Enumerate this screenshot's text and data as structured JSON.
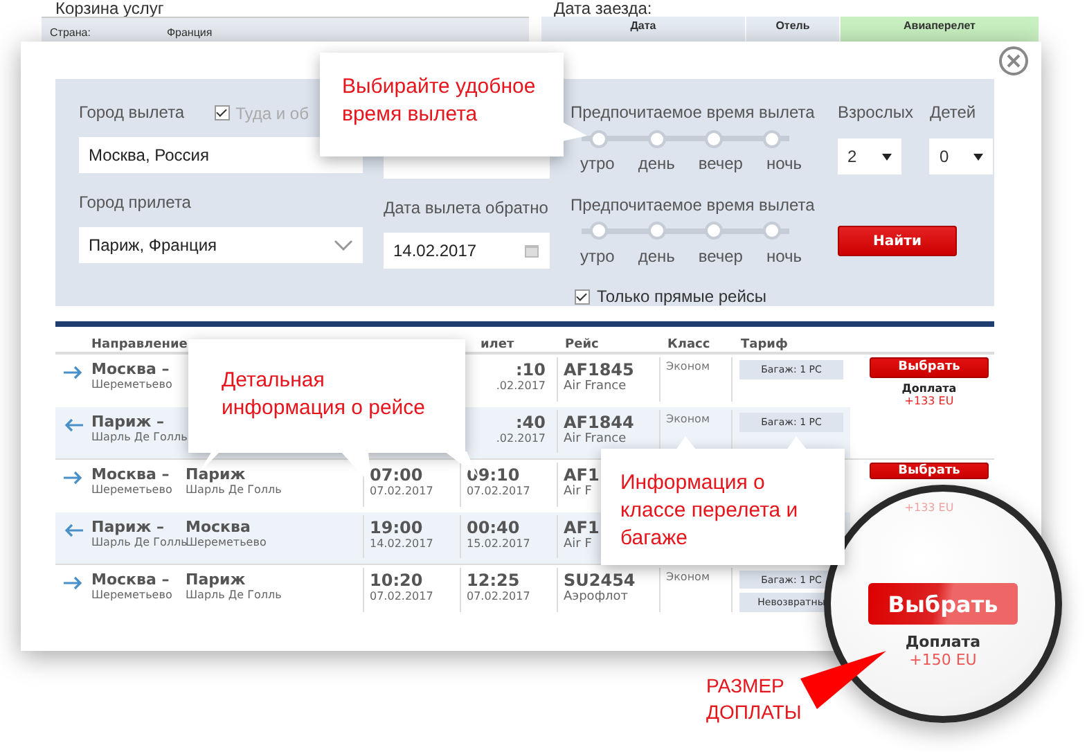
{
  "background_page": {
    "cart_title": "Корзина услуг",
    "country_label": "Страна:",
    "country_value": "Франция",
    "checkin_label": "Дата заезда:",
    "columns": [
      "Дата",
      "Отель",
      "Авиаперелет"
    ]
  },
  "search": {
    "departure_city_label": "Город вылета",
    "round_trip": {
      "label": "Туда и об",
      "checked": true
    },
    "departure_city": "Москва, Россия",
    "arrival_city_label": "Город прилета",
    "arrival_city": "Париж, Франция",
    "return_date_label": "Дата вылета обратно",
    "return_date": "14.02.2017",
    "time_sliders": [
      {
        "label": "Предпочитаемое время вылета",
        "options": [
          {
            "label": "утро",
            "selected": false
          },
          {
            "label": "день",
            "selected": false
          },
          {
            "label": "вечер",
            "selected": false
          },
          {
            "label": "ночь",
            "selected": false
          }
        ]
      },
      {
        "label": "Предпочитаемое время вылета",
        "options": [
          {
            "label": "утро",
            "selected": false
          },
          {
            "label": "день",
            "selected": false
          },
          {
            "label": "вечер",
            "selected": false
          },
          {
            "label": "ночь",
            "selected": false
          }
        ]
      }
    ],
    "adults_label": "Взрослых",
    "adults": "2",
    "children_label": "Детей",
    "children": "0",
    "search_button": "Найти",
    "direct_only": {
      "label": "Только прямые рейсы",
      "checked": true
    }
  },
  "results": {
    "columns": [
      "Направление",
      "илет",
      "Рейс",
      "Класс",
      "Тариф"
    ],
    "rows": [
      {
        "kind": "outbound",
        "from": {
          "city": "Москва –",
          "airport": "Шереметьево"
        },
        "arrival": {
          "time": ":10",
          "date": ".02.2017"
        },
        "flight": {
          "number": "AF1845",
          "airline": "Air France"
        },
        "class": "Эконом",
        "tariffs": [
          "Багаж: 1 PC"
        ],
        "action": {
          "button": "Выбрать",
          "surcharge_label": "Доплата",
          "surcharge": "+133 EU"
        }
      },
      {
        "kind": "return",
        "from": {
          "city": "Париж –",
          "airport": "Шарль Де Голль"
        },
        "arrival": {
          "time": ":40",
          "date": ".02.2017"
        },
        "flight": {
          "number": "AF1844",
          "airline": "Air France"
        },
        "class": "Эконом",
        "tariffs": [
          "Багаж: 1 PC"
        ]
      },
      {
        "kind": "outbound",
        "from": {
          "city": "Москва –",
          "airport": "Шереметьево"
        },
        "to": {
          "city": "Париж",
          "airport": "Шарль Де Голль"
        },
        "departure": {
          "time": "07:00",
          "date": "07.02.2017"
        },
        "arrival": {
          "time": "09:10",
          "date": "07.02.2017"
        },
        "flight": {
          "number": "AF1",
          "airline": "Air F"
        },
        "action": {
          "button": "Выбрать",
          "surcharge": "+133 EU"
        }
      },
      {
        "kind": "return",
        "from": {
          "city": "Париж –",
          "airport": "Шарль Де Голль"
        },
        "to": {
          "city": "Москва",
          "airport": "Шереметьево"
        },
        "departure": {
          "time": "19:00",
          "date": "14.02.2017"
        },
        "arrival": {
          "time": "00:40",
          "date": "15.02.2017"
        },
        "flight": {
          "number": "AF1",
          "airline": "Air F"
        }
      },
      {
        "kind": "outbound",
        "from": {
          "city": "Москва –",
          "airport": "Шереметьево"
        },
        "to": {
          "city": "Париж",
          "airport": "Шарль Де Голль"
        },
        "departure": {
          "time": "10:20",
          "date": "07.02.2017"
        },
        "arrival": {
          "time": "12:25",
          "date": "07.02.2017"
        },
        "flight": {
          "number": "SU2454",
          "airline": "Аэрофлот"
        },
        "class": "Эконом",
        "tariffs": [
          "Багаж: 1 PC",
          "Невозвратны"
        ]
      }
    ]
  },
  "magnifier": {
    "button": "Выбрать",
    "surcharge_label": "Доплата",
    "surcharge": "+150 EU"
  },
  "callouts": {
    "departure_time": "Выбирайте удобное время вылета",
    "flight_details": "Детальная информация о рейсе",
    "class_baggage": "Информация о классе перелета и багаже",
    "surcharge_note": "РАЗМЕР ДОПЛАТЫ"
  }
}
